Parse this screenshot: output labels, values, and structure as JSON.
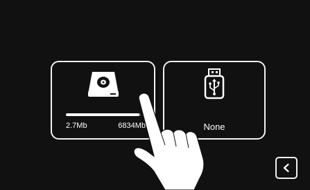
{
  "storage": {
    "internal": {
      "icon": "hard-drive-icon",
      "used": "2.7Mb",
      "total": "6834Mb",
      "used_fraction": 0.98
    },
    "usb": {
      "icon": "usb-drive-icon",
      "status": "None"
    }
  },
  "navigation": {
    "back_icon": "chevron-left-icon"
  },
  "colors": {
    "background": "#111111",
    "foreground": "#ffffff",
    "track": "#555555"
  }
}
